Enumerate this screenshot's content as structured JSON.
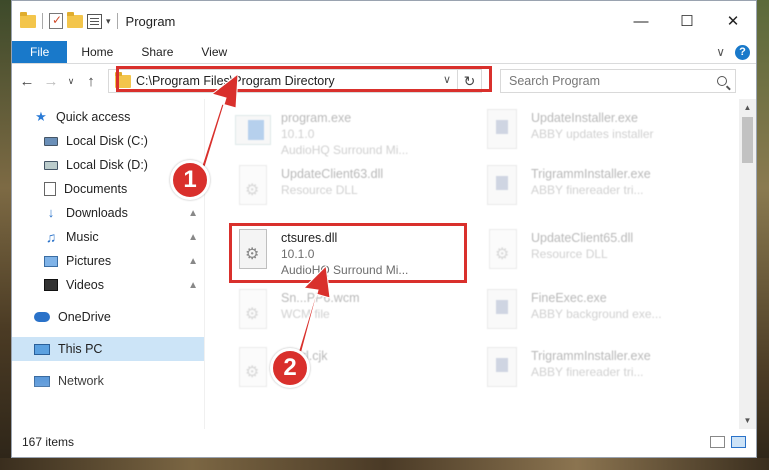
{
  "window": {
    "title": "Program",
    "minimize": "—",
    "maximize": "☐",
    "close": "✕"
  },
  "ribbon": {
    "tabs": [
      "File",
      "Home",
      "Share",
      "View"
    ],
    "expand": "∨",
    "help": "?"
  },
  "nav": {
    "back": "←",
    "forward": "→",
    "recent": "∨",
    "up": "↑"
  },
  "address": {
    "path": "C:\\Program Files\\Program Directory",
    "dropdown": "∨",
    "refresh": "↻"
  },
  "search": {
    "placeholder": "Search Program"
  },
  "sidebar": {
    "quick_access": "Quick access",
    "items": [
      {
        "label": "Local Disk (C:)",
        "pinned": false
      },
      {
        "label": "Local Disk (D:)",
        "pinned": false
      },
      {
        "label": "Documents",
        "pinned": false
      },
      {
        "label": "Downloads",
        "pinned": true
      },
      {
        "label": "Music",
        "pinned": true
      },
      {
        "label": "Pictures",
        "pinned": true
      },
      {
        "label": "Videos",
        "pinned": true
      }
    ],
    "onedrive": "OneDrive",
    "this_pc": "This PC",
    "network": "Network",
    "pin_glyph": "📌"
  },
  "files": [
    {
      "name": "program.exe",
      "line2": "10.1.0",
      "line3": "AudioHQ Surround Mi...",
      "kind": "exe",
      "faded": true
    },
    {
      "name": "UpdateInstaller.exe",
      "line2": "ABBY updates installer",
      "line3": "",
      "kind": "installer",
      "faded": true
    },
    {
      "name": "UpdateClient63.dll",
      "line2": "Resource DLL",
      "line3": "",
      "kind": "dll",
      "faded": true
    },
    {
      "name": "TrigrammInstaller.exe",
      "line2": "ABBY finereader tri...",
      "line3": "",
      "kind": "installer",
      "faded": true
    },
    {
      "name": "ctsures.dll",
      "line2": "10.1.0",
      "line3": "AudioHQ Surround Mi...",
      "kind": "dll",
      "faded": false
    },
    {
      "name": "UpdateClient65.dll",
      "line2": "Resource DLL",
      "line3": "",
      "kind": "dll",
      "faded": true
    },
    {
      "name": "Sn...PP6.wcm",
      "line2": "WCM file",
      "line3": "",
      "kind": "dll",
      "faded": true
    },
    {
      "name": "FineExec.exe",
      "line2": "ABBY background exe...",
      "line3": "",
      "kind": "installer",
      "faded": true
    },
    {
      "name": "...ntrl.cjk",
      "line2": "...",
      "line3": "",
      "kind": "dll",
      "faded": true
    },
    {
      "name": "TrigrammInstaller.exe",
      "line2": "ABBY finereader tri...",
      "line3": "",
      "kind": "installer",
      "faded": true
    }
  ],
  "status": {
    "count": "167 items"
  },
  "callouts": [
    "1",
    "2"
  ],
  "colors": {
    "accent": "#1979ca",
    "highlight": "#d9302c",
    "selected": "#cce4f7"
  }
}
